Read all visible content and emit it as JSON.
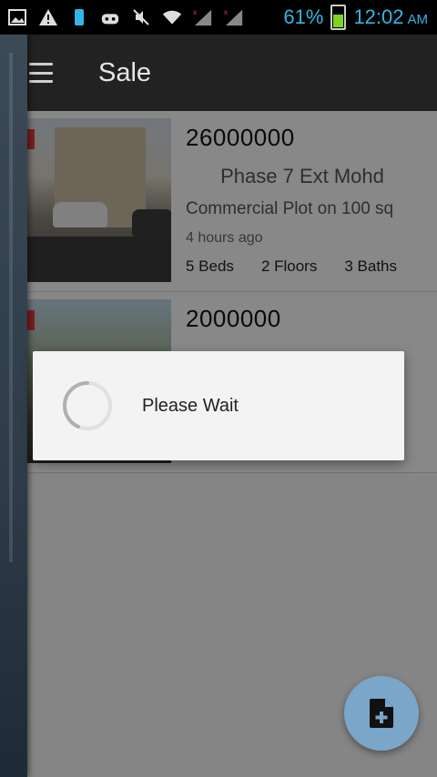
{
  "status_bar": {
    "battery_percent": "61%",
    "time": "12:02",
    "ampm": "AM",
    "icons": [
      "gallery-icon",
      "warning-icon",
      "phone-icon",
      "android-icon",
      "mute-icon",
      "wifi-icon",
      "signal-1-icon",
      "signal-2-icon",
      "battery-icon"
    ]
  },
  "app_bar": {
    "title": "Sale"
  },
  "listings": [
    {
      "price": "26000000",
      "location": "Phase 7 Ext Mohd",
      "description": "Commercial Plot on 100 sq",
      "posted": "4 hours ago",
      "beds": "5 Beds",
      "floors": "2 Floors",
      "baths": "3 Baths"
    },
    {
      "price": "2000000"
    }
  ],
  "dialog": {
    "message": "Please Wait"
  },
  "colors": {
    "accent": "#33b5e5",
    "appbar": "#222222",
    "fab": "#7aa6c9"
  }
}
